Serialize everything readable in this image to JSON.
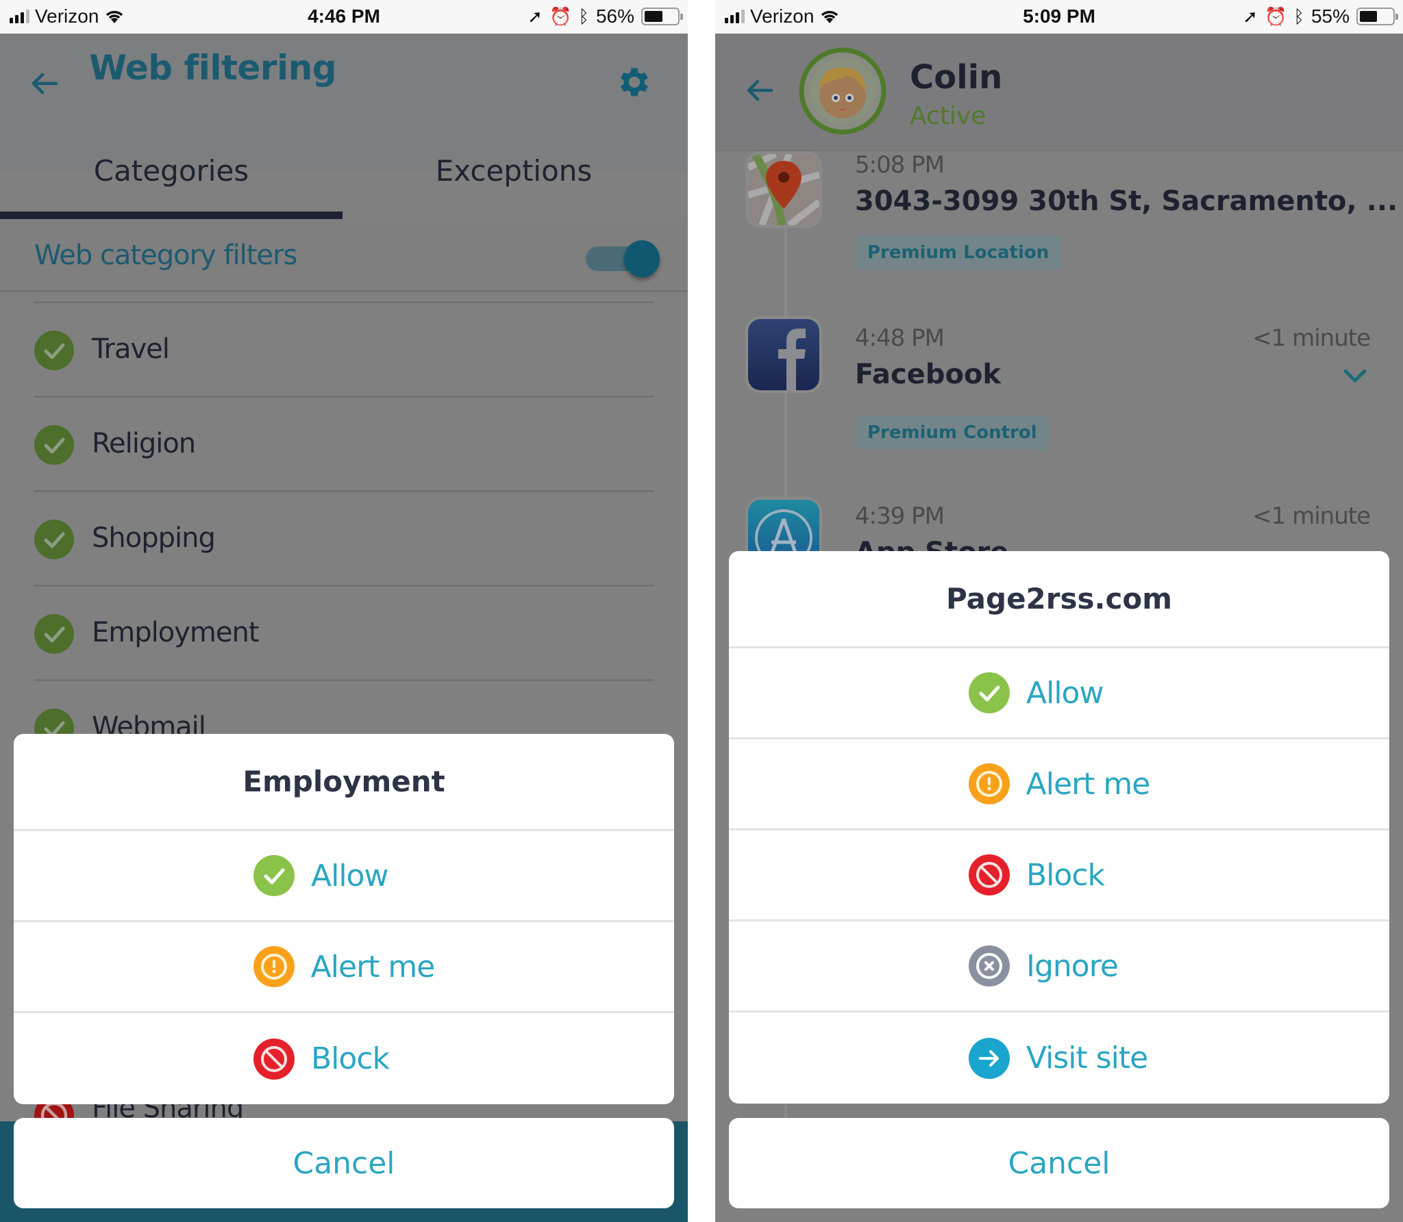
{
  "left_screen": {
    "status_bar": {
      "carrier": "Verizon",
      "time": "4:46 PM",
      "battery": "56%",
      "battery_level": 0.56
    },
    "header": {
      "title": "Web filtering",
      "back_icon": "arrow-left-icon",
      "settings_icon": "gear-icon"
    },
    "tabs": [
      {
        "label": "Categories",
        "active": true
      },
      {
        "label": "Exceptions",
        "active": false
      }
    ],
    "filter_toggle": {
      "label": "Web category filters",
      "on": true
    },
    "categories": [
      {
        "label": "Travel",
        "status": "allow"
      },
      {
        "label": "Religion",
        "status": "allow"
      },
      {
        "label": "Shopping",
        "status": "allow"
      },
      {
        "label": "Employment",
        "status": "allow"
      },
      {
        "label": "Webmail",
        "status": "allow"
      },
      {
        "label": "File Sharing",
        "status": "block"
      }
    ],
    "action_sheet": {
      "title": "Employment",
      "options": [
        {
          "label": "Allow",
          "icon": "check-circle-icon",
          "color": "#8bc34a"
        },
        {
          "label": "Alert me",
          "icon": "alert-circle-icon",
          "color": "#f9a11b"
        },
        {
          "label": "Block",
          "icon": "block-circle-icon",
          "color": "#e5202a"
        }
      ],
      "cancel": "Cancel"
    }
  },
  "right_screen": {
    "status_bar": {
      "carrier": "Verizon",
      "time": "5:09 PM",
      "battery": "55%",
      "battery_level": 0.55
    },
    "header": {
      "name": "Colin",
      "status": "Active"
    },
    "timeline": [
      {
        "time": "5:08 PM",
        "title": "3043-3099 30th St, Sacramento, ...",
        "duration": "",
        "badge": "Premium Location",
        "icon": "map-pin-icon"
      },
      {
        "time": "4:48 PM",
        "title": "Facebook",
        "duration": "<1 minute",
        "badge": "Premium Control",
        "icon": "facebook-icon"
      },
      {
        "time": "4:39 PM",
        "title": "App Store",
        "duration": "<1 minute",
        "badge": "",
        "icon": "app-store-icon"
      }
    ],
    "action_sheet": {
      "title": "Page2rss.com",
      "options": [
        {
          "label": "Allow",
          "icon": "check-circle-icon",
          "color": "#8bc34a"
        },
        {
          "label": "Alert me",
          "icon": "alert-circle-icon",
          "color": "#f9a11b"
        },
        {
          "label": "Block",
          "icon": "block-circle-icon",
          "color": "#e5202a"
        },
        {
          "label": "Ignore",
          "icon": "ignore-circle-icon",
          "color": "#8a90a0"
        },
        {
          "label": "Visit site",
          "icon": "arrow-circle-icon",
          "color": "#1aa5cf"
        }
      ],
      "cancel": "Cancel"
    }
  },
  "colors": {
    "accent_teal": "#2aa6c2",
    "header_teal": "#1c5a70",
    "overlay_gray": "#808080",
    "active_green": "#4f7a2a"
  }
}
